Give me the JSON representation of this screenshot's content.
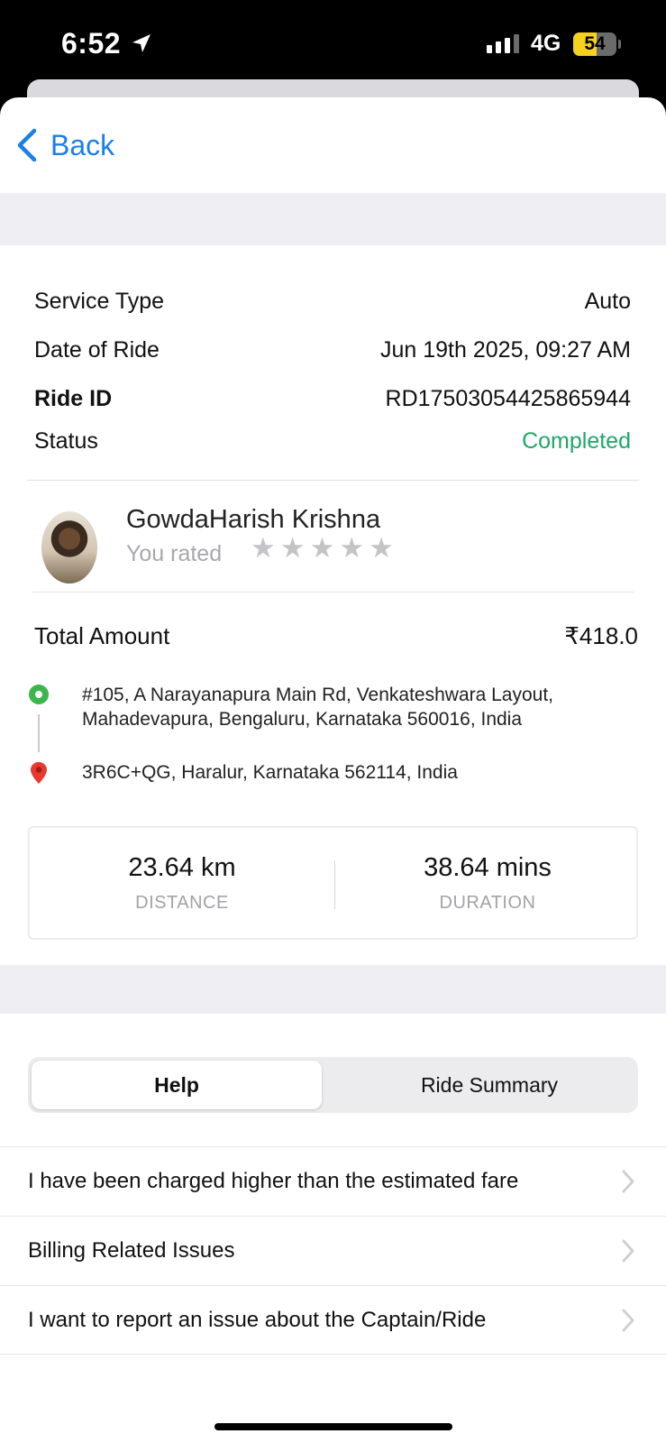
{
  "status_bar": {
    "time": "6:52",
    "network": "4G",
    "battery": "54",
    "battery_level": 0.54
  },
  "nav": {
    "back_label": "Back"
  },
  "ride": {
    "service_type_label": "Service Type",
    "service_type": "Auto",
    "date_label": "Date of Ride",
    "date": "Jun 19th 2025, 09:27 AM",
    "ride_id_label": "Ride ID",
    "ride_id": "RD17503054425865944",
    "status_label": "Status",
    "status": "Completed"
  },
  "driver": {
    "name": "GowdaHarish Krishna",
    "rated_label": "You rated",
    "rating": 0,
    "max_rating": 5
  },
  "fare": {
    "label": "Total Amount",
    "amount": "₹418.0"
  },
  "locations": {
    "pickup": "#105, A Narayanapura Main Rd, Venkateshwara Layout, Mahadevapura, Bengaluru, Karnataka 560016, India",
    "drop": "3R6C+QG, Haralur, Karnataka 562114, India"
  },
  "stats": {
    "distance_value": "23.64 km",
    "distance_label": "DISTANCE",
    "duration_value": "38.64 mins",
    "duration_label": "DURATION"
  },
  "tabs": [
    {
      "label": "Help",
      "active": true
    },
    {
      "label": "Ride Summary",
      "active": false
    }
  ],
  "help_items": [
    {
      "label": "I have been charged higher than the estimated fare"
    },
    {
      "label": "Billing Related Issues"
    },
    {
      "label": "I want to report an issue about the Captain/Ride"
    }
  ],
  "colors": {
    "accent": "#1a7fe8",
    "status_completed": "#1ea866",
    "pickup_pin": "#3cb54a",
    "drop_pin": "#e8392f",
    "battery": "#f7d21c"
  }
}
